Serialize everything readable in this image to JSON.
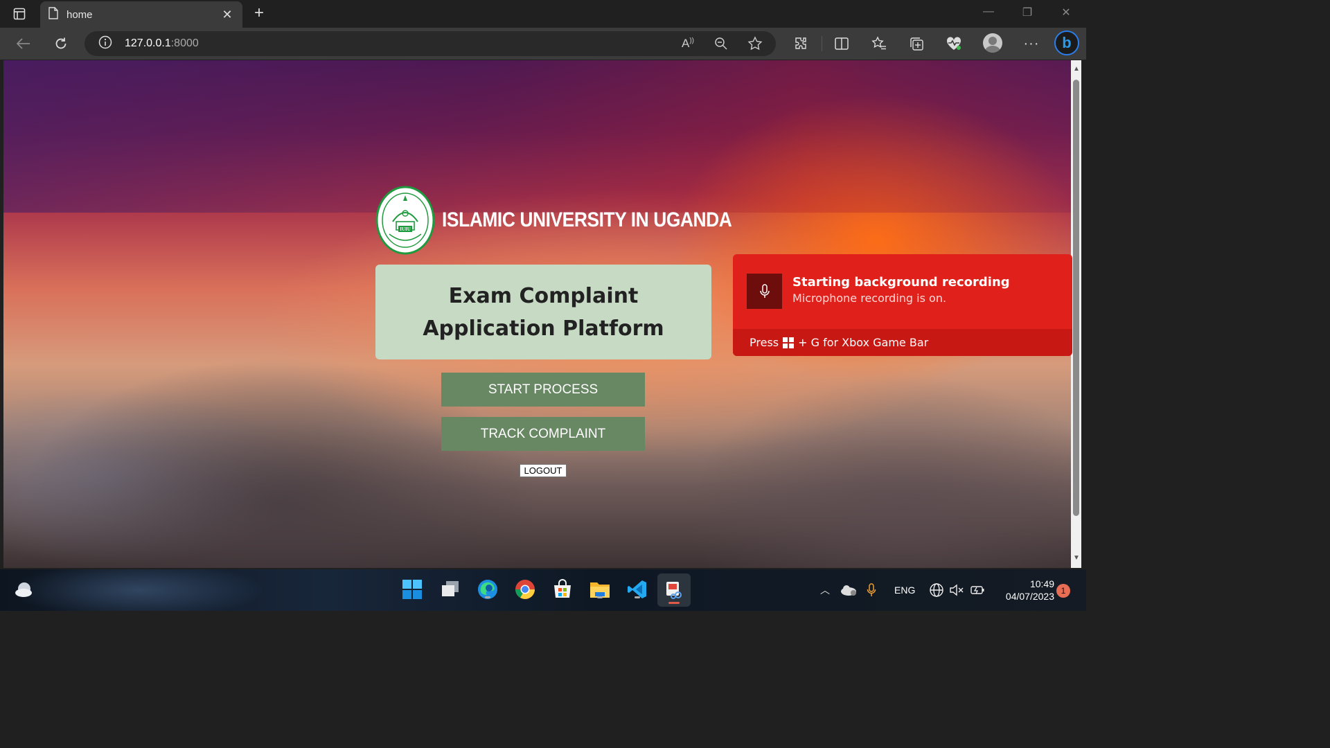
{
  "browser": {
    "tab_title": "home",
    "url_host": "127.0.0.1",
    "url_port": ":8000"
  },
  "page": {
    "university_name": "ISLAMIC UNIVERSITY IN UGANDA",
    "seal_text": "IUIU",
    "title": "Exam Complaint Application Platform",
    "start_button": "START PROCESS",
    "track_button": "TRACK COMPLAINT",
    "logout_button": "LOGOUT"
  },
  "toast": {
    "title": "Starting background recording",
    "subtitle": "Microphone recording is on.",
    "footer_prefix": "Press",
    "footer_suffix": "+ G for Xbox Game Bar"
  },
  "taskbar": {
    "language": "ENG",
    "time": "10:49",
    "date": "04/07/2023",
    "notification_count": "1"
  },
  "colors": {
    "button_green": "#688763",
    "title_card_bg": "#c6dac4",
    "toast_red": "#e0201b",
    "seal_green": "#1f9a3e"
  }
}
